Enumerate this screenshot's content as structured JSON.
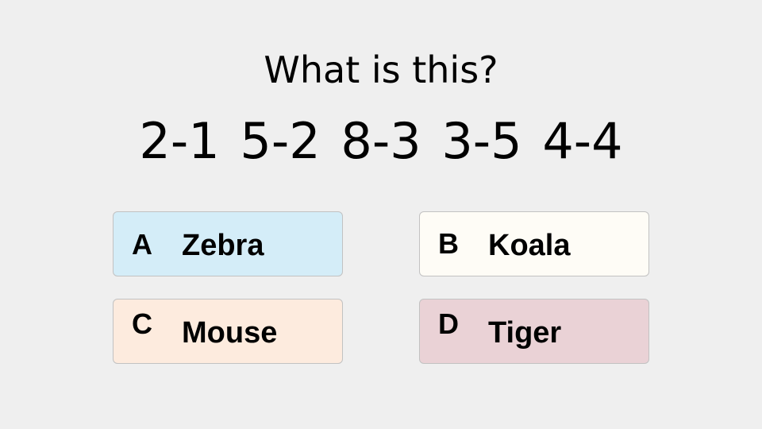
{
  "quiz": {
    "question": "What is this?",
    "code": "2-1 5-2 8-3 3-5 4-4",
    "options": [
      {
        "letter": "A",
        "answer": "Zebra",
        "color": "#d4edf8"
      },
      {
        "letter": "B",
        "answer": "Koala",
        "color": "#fefcf6"
      },
      {
        "letter": "C",
        "answer": "Mouse",
        "color": "#fdebde"
      },
      {
        "letter": "D",
        "answer": "Tiger",
        "color": "#ead2d6"
      }
    ]
  },
  "theme": {
    "background": "#efefef",
    "border": "#c2c2c2",
    "text": "#000000"
  }
}
